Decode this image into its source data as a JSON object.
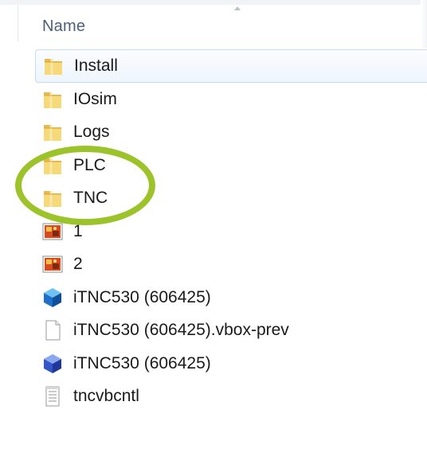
{
  "header": {
    "column_label": "Name",
    "sort_icon": "sort-caret-icon"
  },
  "files": [
    {
      "name": "Install",
      "icon": "folder-icon",
      "type": "folder",
      "selected": true
    },
    {
      "name": "IOsim",
      "icon": "folder-icon",
      "type": "folder",
      "selected": false
    },
    {
      "name": "Logs",
      "icon": "folder-icon",
      "type": "folder",
      "selected": false
    },
    {
      "name": "PLC",
      "icon": "folder-icon",
      "type": "folder",
      "selected": false
    },
    {
      "name": "TNC",
      "icon": "folder-icon",
      "type": "folder",
      "selected": false
    },
    {
      "name": "1",
      "icon": "image-file-icon",
      "type": "image",
      "selected": false
    },
    {
      "name": "2",
      "icon": "image-file-icon",
      "type": "image",
      "selected": false
    },
    {
      "name": "iTNC530 (606425)",
      "icon": "virtualbox-vm-icon",
      "type": "vbox",
      "selected": false
    },
    {
      "name": "iTNC530 (606425).vbox-prev",
      "icon": "blank-file-icon",
      "type": "file",
      "selected": false
    },
    {
      "name": "iTNC530 (606425)",
      "icon": "virtualbox-disk-icon",
      "type": "vdi",
      "selected": false
    },
    {
      "name": "tncvbcntl",
      "icon": "text-file-icon",
      "type": "text",
      "selected": false
    }
  ],
  "annotation": {
    "highlight_color": "#9cc42a",
    "highlighted_items": [
      "PLC",
      "TNC"
    ]
  },
  "colors": {
    "header_text": "#4c607a",
    "selection_border": "#c5dbf3",
    "folder_yellow": "#f3cf63",
    "vbox_blue": "#2f7fd6"
  }
}
